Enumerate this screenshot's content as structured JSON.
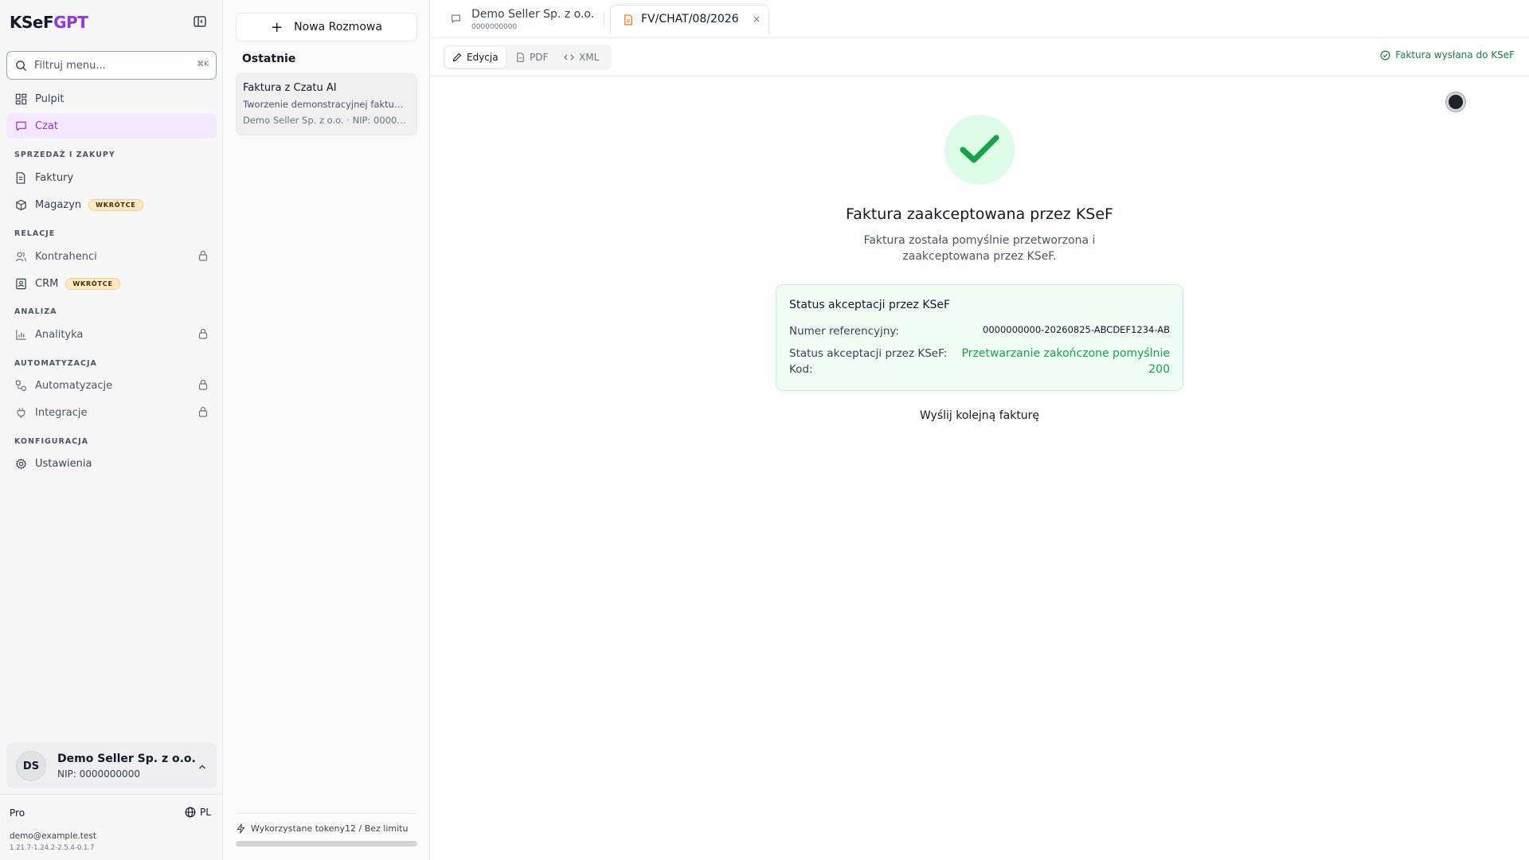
{
  "brand": {
    "part1": "KSeF",
    "part2": "GPT"
  },
  "sidebar": {
    "filter_placeholder": "Filtruj menu...",
    "filter_shortcut": "⌘K",
    "items": {
      "pulpit": "Pulpit",
      "czat": "Czat",
      "faktury": "Faktury",
      "magazyn": "Magazyn",
      "kontrahenci": "Kontrahenci",
      "crm": "CRM",
      "analityka": "Analityka",
      "automatyzacje": "Automatyzacje",
      "integracje": "Integracje",
      "ustawienia": "Ustawienia"
    },
    "badge_soon": "WKRÓTCE",
    "sections": {
      "sales": "SPRZEDAŻ I ZAKUPY",
      "relations": "RELACJE",
      "analysis": "ANALIZA",
      "automation": "AUTOMATYZACJA",
      "config": "KONFIGURACJA"
    },
    "account": {
      "initials": "DS",
      "name": "Demo Seller Sp. z o.o.",
      "nip": "NIP: 0000000000"
    },
    "plan": "Pro",
    "language": "PL",
    "email": "demo@example.test",
    "version": "1.21.7-1.24.2-2.5.4-0.1.7"
  },
  "chats": {
    "new_chat": "Nowa Rozmowa",
    "recent_title": "Ostatnie",
    "items": [
      {
        "title": "Faktura z Czatu AI",
        "subtitle": "Tworzenie demonstracyjnej faktu…",
        "meta": "Demo Seller Sp. z o.o. · NIP: 00000…"
      }
    ],
    "tokens_label": "Wykorzystane tokeny",
    "tokens_value": "12 / Bez limitu"
  },
  "main": {
    "tabs": [
      {
        "label": "Demo Seller Sp. z o.o.",
        "sub": "0000000000"
      },
      {
        "label": "FV/CHAT/08/2026",
        "close": "×"
      }
    ],
    "toolbar": {
      "edit": "Edycja",
      "pdf": "PDF",
      "xml": "XML"
    },
    "sent_status": "Faktura wysłana do KSeF",
    "headline": "Faktura zaakceptowana przez KSeF",
    "subtext": "Faktura została pomyślnie przetworzona i zaakceptowana przez KSeF.",
    "status_card": {
      "title": "Status akceptacji przez KSeF",
      "ref_label": "Numer referencyjny:",
      "ref_value": "0000000000-20260825-ABCDEF1234-AB",
      "status_label": "Status akceptacji przez KSeF:",
      "status_value": "Przetwarzanie zakończone pomyślnie",
      "code_label": "Kod:",
      "code_value": "200"
    },
    "send_another": "Wyślij kolejną fakturę"
  },
  "colors": {
    "accent": "#9333ea",
    "success": "#16a34a",
    "badge_bg": "#fde9c4"
  },
  "icons": {
    "collapse": "sidebar-collapse-icon",
    "search": "search-icon",
    "dashboard": "grid-icon",
    "chat": "chat-bubble-icon",
    "invoice": "document-icon",
    "warehouse": "box-icon",
    "contacts": "users-icon",
    "crm": "contact-card-icon",
    "analytics": "bar-chart-icon",
    "automation": "workflow-icon",
    "integration": "plug-icon",
    "settings": "gear-icon",
    "lock": "lock-icon",
    "globe": "globe-icon",
    "zap": "zap-icon",
    "check": "check-icon"
  }
}
